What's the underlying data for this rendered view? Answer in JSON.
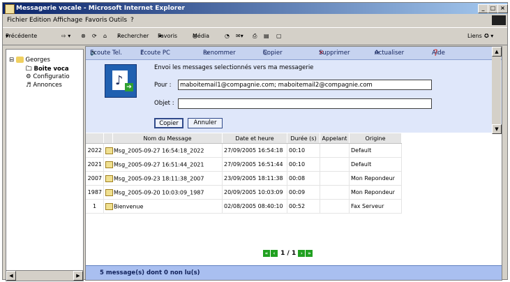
{
  "window": {
    "title": "Messagerie vocale - Microsoft Internet Explorer",
    "controls": [
      "_",
      "□",
      "×"
    ]
  },
  "menu": [
    "Fichier",
    "Edition",
    "Affichage",
    "Favoris",
    "Outils",
    "?"
  ],
  "toolbar": {
    "back": "Précédente",
    "search": "Rechercher",
    "favorites": "Favoris",
    "media": "Média",
    "links": "Liens"
  },
  "tree": {
    "root": "Georges",
    "items": [
      "Boite voca",
      "Configuratio",
      "Annonces"
    ]
  },
  "app_toolbar": {
    "listen_tel": "Ecoute Tel.",
    "listen_pc": "Ecoute PC",
    "rename": "Renommer",
    "copy": "Copier",
    "delete": "Supprimer",
    "refresh": "Actualiser",
    "help": "Aide"
  },
  "copy_panel": {
    "instruction": "Envoi les messages selectionnés vers ma messagerie",
    "to_label": "Pour :",
    "to_value": "maboitemail1@compagnie.com; maboitemail2@compagnie.com",
    "subject_label": "Objet :",
    "subject_value": "",
    "copy_button": "Copier",
    "cancel_button": "Annuler"
  },
  "table": {
    "headers": [
      "",
      "",
      "Nom du Message",
      "Date et heure",
      "Durée (s)",
      "Appelant",
      "Origine"
    ],
    "rows": [
      {
        "id": "2022",
        "name": "Msg_2005-09-27 16:54:18_2022",
        "date": "27/09/2005 16:54:18",
        "duration": "00:10",
        "caller": "",
        "origin": "Default"
      },
      {
        "id": "2021",
        "name": "Msg_2005-09-27 16:51:44_2021",
        "date": "27/09/2005 16:51:44",
        "duration": "00:10",
        "caller": "",
        "origin": "Default"
      },
      {
        "id": "2007",
        "name": "Msg_2005-09-23 18:11:38_2007",
        "date": "23/09/2005 18:11:38",
        "duration": "00:08",
        "caller": "",
        "origin": "Mon Repondeur"
      },
      {
        "id": "1987",
        "name": "Msg_2005-09-20 10:03:09_1987",
        "date": "20/09/2005 10:03:09",
        "duration": "00:09",
        "caller": "",
        "origin": "Mon Repondeur"
      },
      {
        "id": "1",
        "name": "Bienvenue",
        "date": "02/08/2005 08:40:10",
        "duration": "00:52",
        "caller": "",
        "origin": "Fax Serveur"
      }
    ]
  },
  "pager": {
    "text": "1 / 1"
  },
  "status": "5 message(s) dont 0 non lu(s)"
}
